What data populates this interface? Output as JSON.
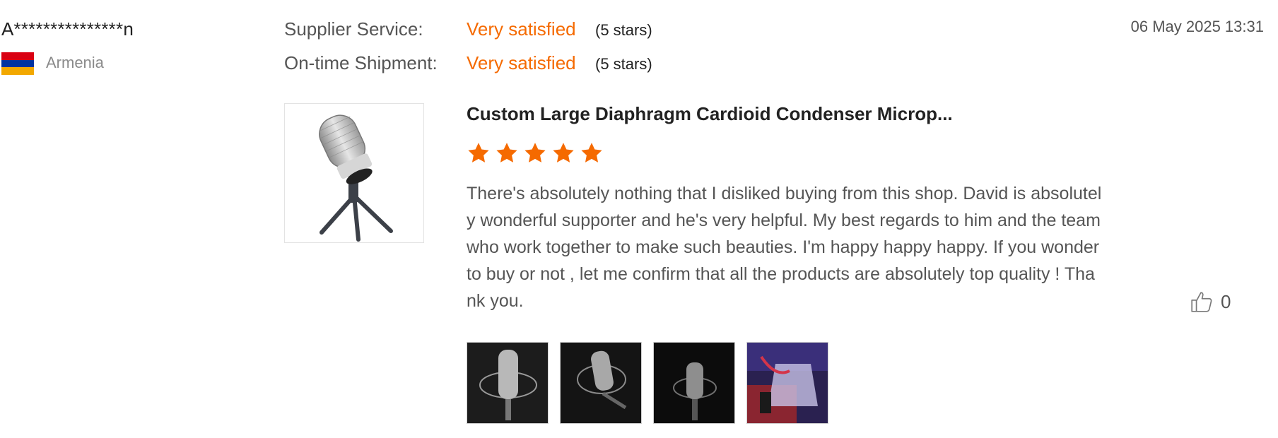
{
  "reviewer": {
    "name": "A***************n",
    "country": "Armenia",
    "flag_colors": [
      "#d90012",
      "#0033a0",
      "#f2a800"
    ]
  },
  "ratings": [
    {
      "label": "Supplier Service:",
      "value": "Very satisfied",
      "stars_text": "(5 stars)"
    },
    {
      "label": "On-time Shipment:",
      "value": "Very satisfied",
      "stars_text": "(5 stars)"
    }
  ],
  "date": "06 May 2025 13:31",
  "product": {
    "title": "Custom Large Diaphragm Cardioid Condenser Microp...",
    "thumbnail_icon": "microphone-on-stand-image",
    "rating": 5
  },
  "review_text": "There's absolutely nothing that I disliked buying from this shop. David is absolutely wonderful supporter and he's very helpful. My best regards to him and the team who work together to make such beauties. I'm happy happy happy. If you wonder to buy or not , let me confirm that all the products are absolutely top quality ! Thank you.",
  "like": {
    "count": "0",
    "icon": "thumbs-up-icon"
  },
  "photos": [
    "microphone-photo",
    "microphone-photo",
    "microphone-photo",
    "studio-photo"
  ],
  "colors": {
    "accent": "#f56a00"
  }
}
